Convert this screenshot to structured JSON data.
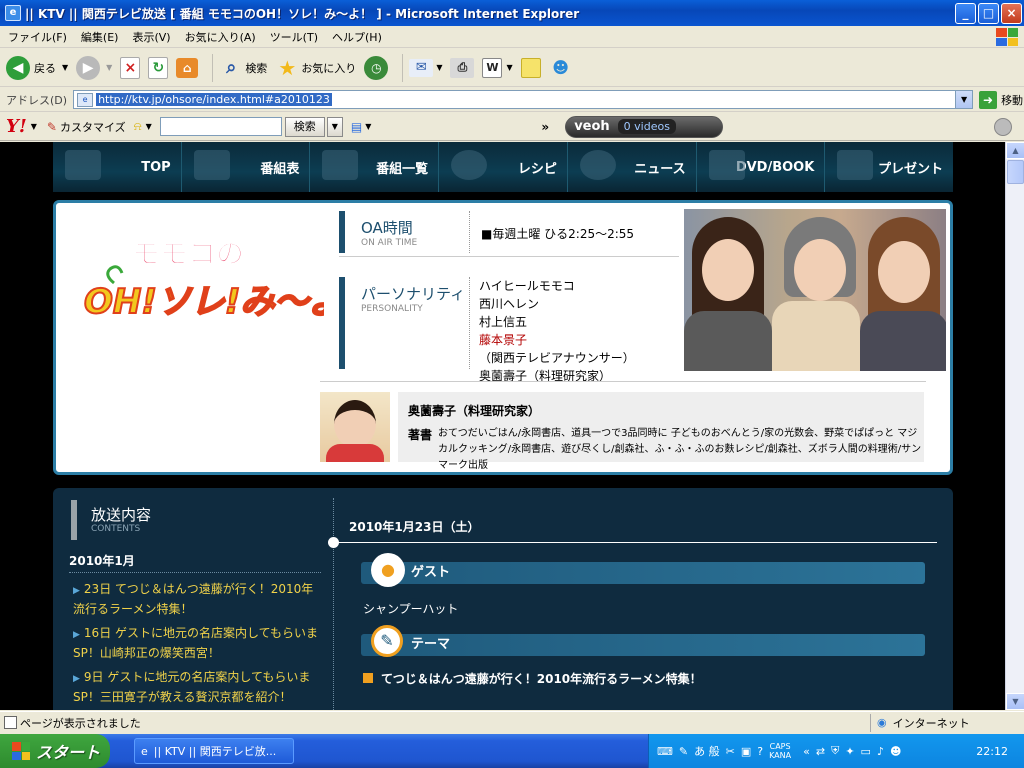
{
  "window": {
    "title": "|| KTV || 関西テレビ放送 [ 番組 モモコのOH！ソレ！み〜よ！ ] - Microsoft Internet Explorer",
    "min": "_",
    "max": "□",
    "close": "×"
  },
  "menu": [
    "ファイル(F)",
    "編集(E)",
    "表示(V)",
    "お気に入り(A)",
    "ツール(T)",
    "ヘルプ(H)"
  ],
  "toolbar": {
    "back": "戻る",
    "search": "検索",
    "favorites": "お気に入り"
  },
  "address": {
    "label": "アドレス(D)",
    "url": "http://ktv.jp/ohsore/index.html#a2010123",
    "go": "移動"
  },
  "yahoo": {
    "logo": "Y!",
    "customize": "カスタマイズ",
    "search_button": "検索",
    "veoh": "veoh",
    "videos": "0 videos"
  },
  "site": {
    "nav": [
      "TOP",
      "番組表",
      "番組一覧",
      "レシピ",
      "ニュース",
      "DVD/BOOK",
      "プレゼント"
    ],
    "logo_line1": "モモコの",
    "logo_line2": "OH!ソレ!み〜よ!",
    "oa_title": "OA時間",
    "oa_sub": "ON AIR TIME",
    "oa_value": "■毎週土曜 ひる2:25〜2:55",
    "personality_title": "パーソナリティ",
    "personality_sub": "PERSONALITY",
    "personalities": [
      {
        "name": "ハイヒールモモコ",
        "role": ""
      },
      {
        "name": "西川ヘレン",
        "role": ""
      },
      {
        "name": "村上信五",
        "role": ""
      },
      {
        "name": "藤本景子",
        "role": "（関西テレビアナウンサー）"
      },
      {
        "name": "奥薗壽子",
        "role": "（料理研究家）"
      }
    ],
    "chef_name": "奥薗壽子（料理研究家）",
    "books_label": "著書",
    "books": "おてつだいごはん/永岡書店、道具一つで3品同時に 子どものおべんとう/家の光数会、野菜でぱぱっと マジカルクッキング/永岡書店、遊び尽くし/創森社、ふ・ふ・ふのお麩レシピ/創森社、ズボラ人間の料理術/サンマーク出版",
    "contents_title": "放送内容",
    "contents_sub": "CONTENTS",
    "month": "2010年1月",
    "episodes": [
      "23日 てつじ＆はんつ遠藤が行く！2010年流行るラーメン特集！",
      "16日 ゲストに地元の名店案内してもらいまSP！山崎邦正の爆笑西宮！",
      "9日 ゲストに地元の名店案内してもらいまSP！三田寛子が教える贅沢京都を紹介！"
    ],
    "date": "2010年1月23日（土）",
    "guest_header": "ゲスト",
    "guest_name": "シャンプーハット",
    "theme_header": "テーマ",
    "theme_text": "てつじ＆はんつ遠藤が行く！2010年流行るラーメン特集！"
  },
  "status": {
    "message": "ページが表示されました",
    "zone": "インターネット"
  },
  "taskbar": {
    "start": "スタート",
    "task": "|| KTV || 関西テレビ放...",
    "ime": "あ 般",
    "caps": "CAPS",
    "kana": "KANA",
    "clock": "22:12"
  },
  "colors": {
    "titlebar": "#0a55d0",
    "site_bg": "#000000",
    "nav_bg": "#0c3d52",
    "panel_border": "#2c7ea6",
    "lower_bg": "#0f2b3f",
    "episode_link": "#f0d24a",
    "accent_red": "#b30000"
  }
}
